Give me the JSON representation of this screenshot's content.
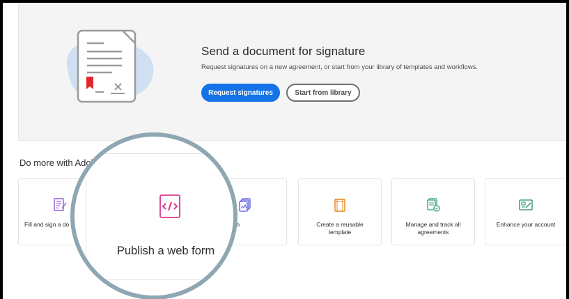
{
  "hero": {
    "title": "Send a document for signature",
    "subtitle": "Request signatures on a new agreement, or start from your library of templates and workflows.",
    "primary_button": "Request signatures",
    "secondary_button": "Start from library"
  },
  "section": {
    "heading": "Do more with Adol"
  },
  "cards": [
    {
      "label": "Fill and sign a do",
      "icon": "fill-sign-icon"
    },
    {
      "label": "d in bulk with\nMega Sign",
      "icon": "bulk-send-icon"
    },
    {
      "label": "Create a reusable\ntemplate",
      "icon": "template-icon"
    },
    {
      "label": "Manage and track all\nagreements",
      "icon": "manage-track-icon"
    },
    {
      "label": "Enhance your account",
      "icon": "enhance-account-icon"
    }
  ],
  "magnified": {
    "label": "Publish a web form",
    "icon": "web-form-code-icon"
  },
  "colors": {
    "primary": "#1473e6",
    "web_form": "#d83790",
    "fill_sign": "#8e5bd6",
    "bulk": "#5c5ce0",
    "template": "#e68619",
    "manage": "#2d9d78",
    "enhance": "#268e6c",
    "magnifier_ring": "#8fa6b3"
  }
}
